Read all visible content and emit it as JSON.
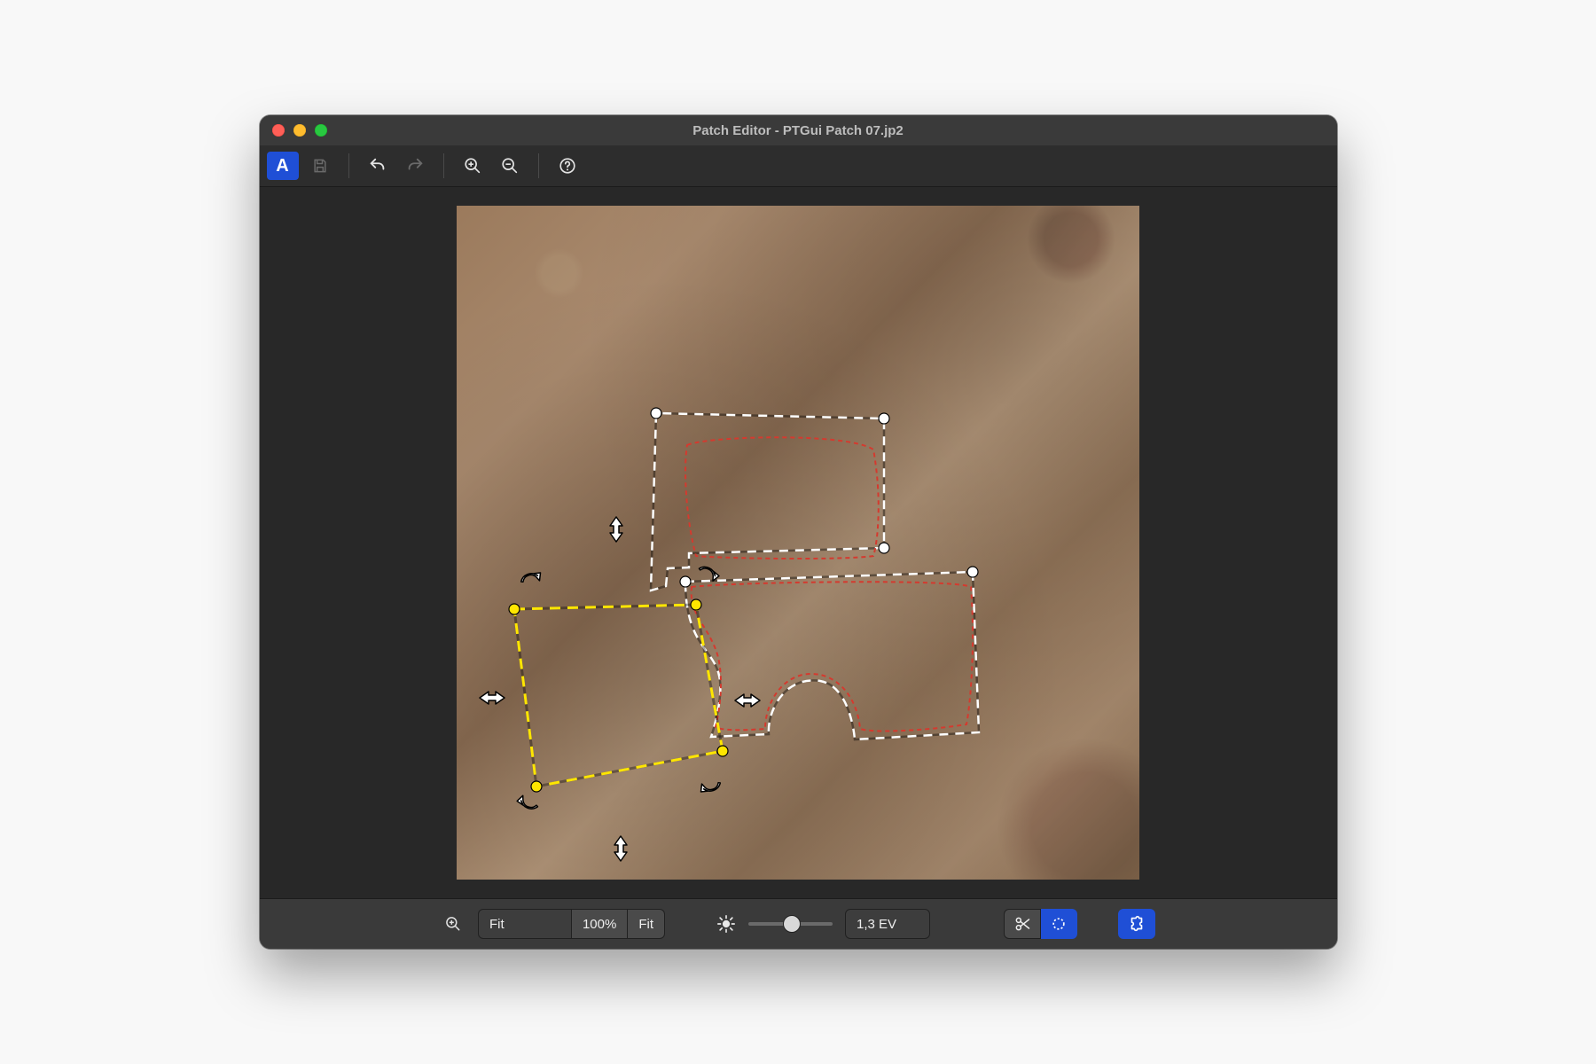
{
  "window": {
    "title": "Patch Editor - PTGui Patch 07.jp2"
  },
  "toolbar": {
    "mode_letter": "A"
  },
  "bottom": {
    "zoom_value": "Fit",
    "btn_100": "100%",
    "btn_fit": "Fit",
    "ev_value": "1,3 EV",
    "slider_pos_pct": 52
  }
}
